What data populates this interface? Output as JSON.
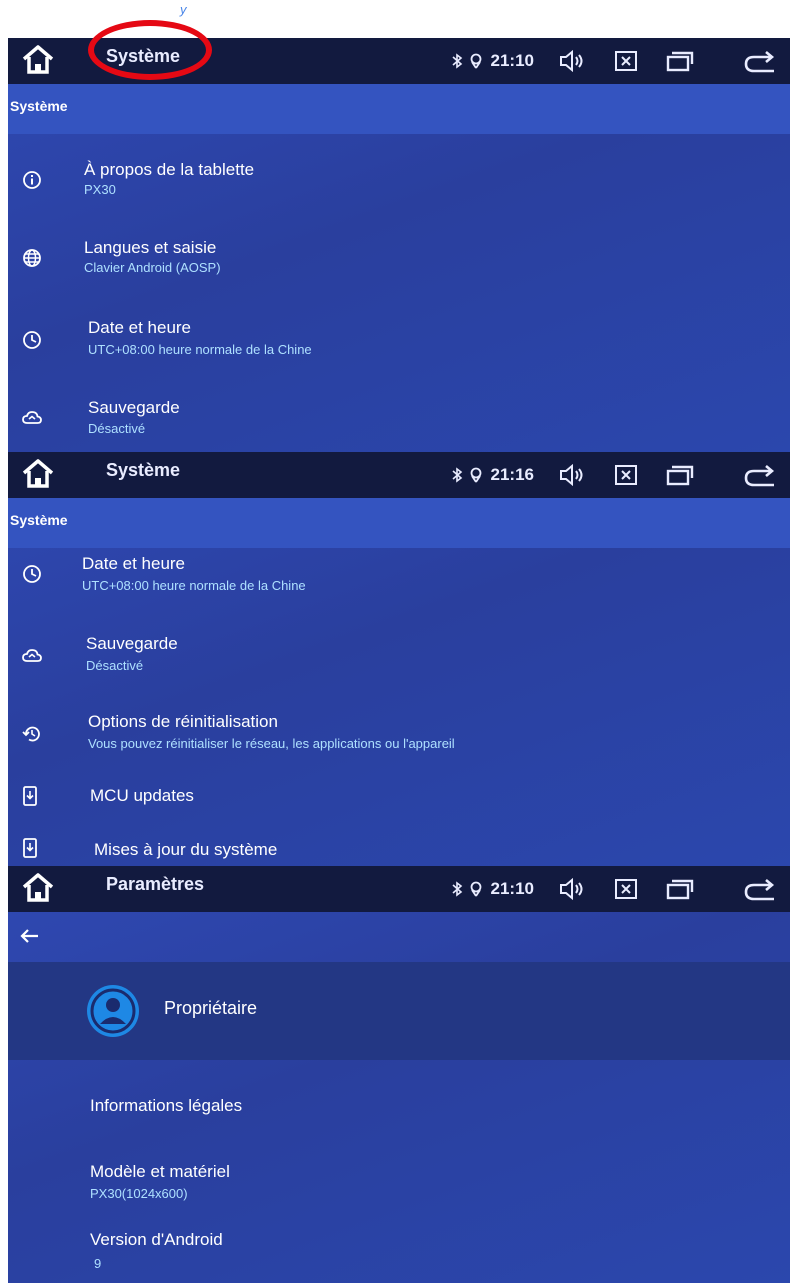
{
  "screens": [
    {
      "status": {
        "title": "Système",
        "time": "21:10"
      },
      "header": "Système",
      "items": [
        {
          "icon": "info-icon",
          "title": "À propos de la tablette",
          "subtitle": "PX30"
        },
        {
          "icon": "globe-icon",
          "title": "Langues et saisie",
          "subtitle": "Clavier Android (AOSP)"
        },
        {
          "icon": "clock-icon",
          "title": "Date et heure",
          "subtitle": "UTC+08:00 heure normale de la Chine"
        },
        {
          "icon": "cloud-icon",
          "title": "Sauvegarde",
          "subtitle": "Désactivé"
        }
      ]
    },
    {
      "status": {
        "title": "Système",
        "time": "21:16"
      },
      "header": "Système",
      "items": [
        {
          "icon": "clock-icon",
          "title": "Date et heure",
          "subtitle": "UTC+08:00 heure normale de la Chine"
        },
        {
          "icon": "cloud-icon",
          "title": "Sauvegarde",
          "subtitle": "Désactivé"
        },
        {
          "icon": "restore-icon",
          "title": "Options de réinitialisation",
          "subtitle": "Vous pouvez réinitialiser le réseau, les applications ou l'appareil"
        },
        {
          "icon": "system-update-icon",
          "title": "MCU updates",
          "subtitle": ""
        },
        {
          "icon": "system-update-icon",
          "title": "Mises à jour du système",
          "subtitle": ""
        }
      ]
    },
    {
      "status": {
        "title": "Paramètres",
        "time": "21:10"
      },
      "owner": "Propriétaire",
      "items": [
        {
          "title": "Informations légales",
          "subtitle": ""
        },
        {
          "title": "Modèle et matériel",
          "subtitle": "PX30(1024x600)"
        },
        {
          "title": "Version d'Android",
          "subtitle": "9"
        }
      ]
    }
  ],
  "colors": {
    "statusbar": "#121a3f",
    "panel": "#2d45aa",
    "subtitle": "#aee0ff",
    "highlight_ring": "#e50914"
  }
}
